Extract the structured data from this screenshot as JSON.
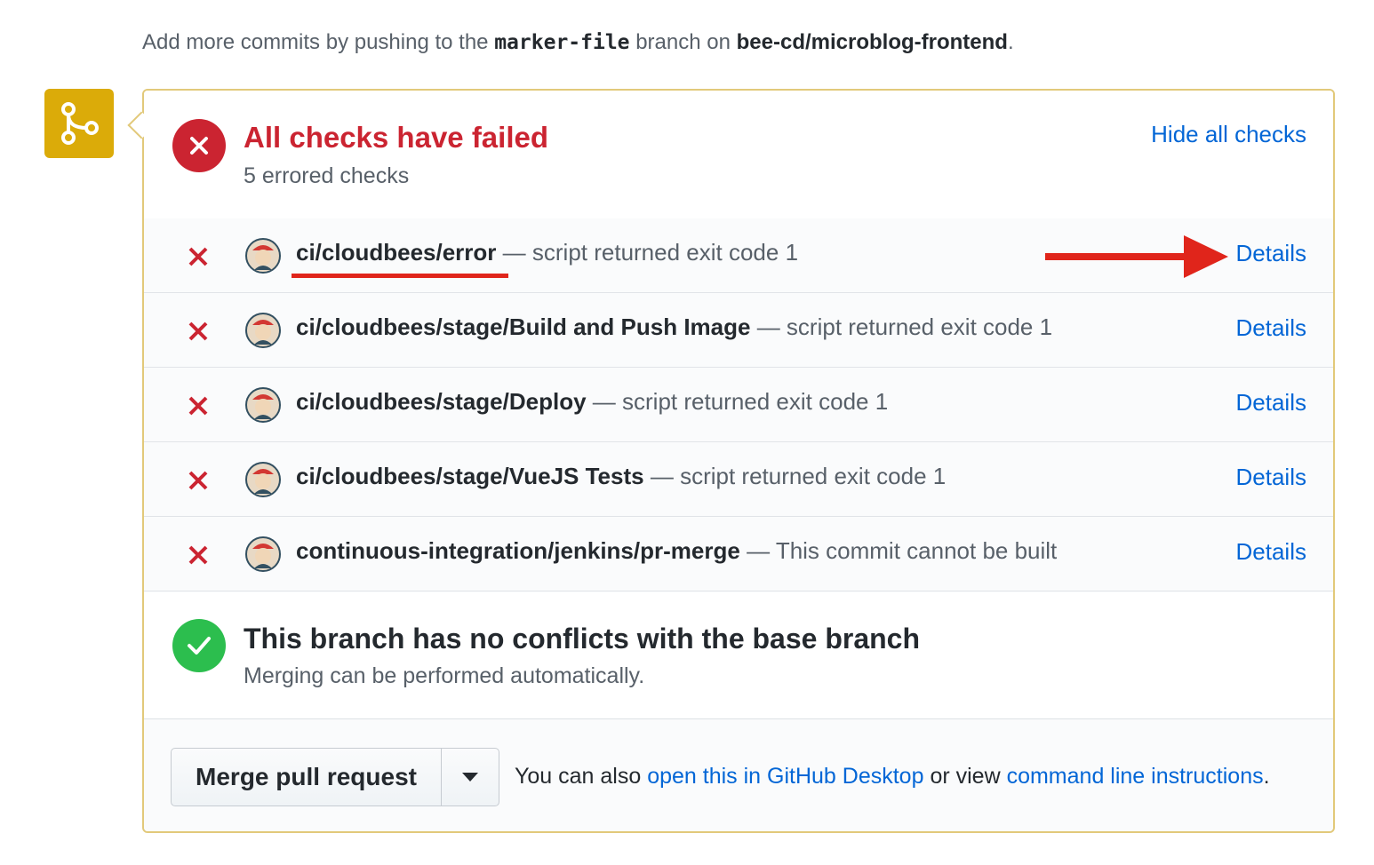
{
  "intro": {
    "prefix": "Add more commits by pushing to the",
    "branch": "marker-file",
    "middle": "branch on",
    "repo": "bee-cd/microblog-frontend",
    "suffix": "."
  },
  "checks_header": {
    "title": "All checks have failed",
    "subtitle": "5 errored checks",
    "hide_link": "Hide all checks"
  },
  "checks": [
    {
      "name": "ci/cloudbees/error",
      "description": "— script returned exit code 1",
      "details": "Details"
    },
    {
      "name": "ci/cloudbees/stage/Build and Push Image",
      "description": "— script returned exit code 1",
      "details": "Details"
    },
    {
      "name": "ci/cloudbees/stage/Deploy",
      "description": "— script returned exit code 1",
      "details": "Details"
    },
    {
      "name": "ci/cloudbees/stage/VueJS Tests",
      "description": "— script returned exit code 1",
      "details": "Details"
    },
    {
      "name": "continuous-integration/jenkins/pr-merge",
      "description": "— This commit cannot be built",
      "details": "Details"
    }
  ],
  "conflicts": {
    "title": "This branch has no conflicts with the base branch",
    "subtitle": "Merging can be performed automatically."
  },
  "merge": {
    "button_label": "Merge pull request",
    "note_prefix": "You can also",
    "desktop_link": "open this in GitHub Desktop",
    "note_middle": "or view",
    "cli_link": "command line instructions",
    "note_suffix": "."
  },
  "colors": {
    "fail": "#cb2431",
    "success": "#2cbe4e",
    "link": "#0366d6",
    "badge": "#dbab09",
    "annotation": "#e0251b"
  },
  "icons": {
    "badge": "git-merge-icon",
    "failed": "x-icon",
    "success": "check-icon",
    "avatar": "jenkins-avatar-icon",
    "caret": "triangle-down-icon"
  }
}
